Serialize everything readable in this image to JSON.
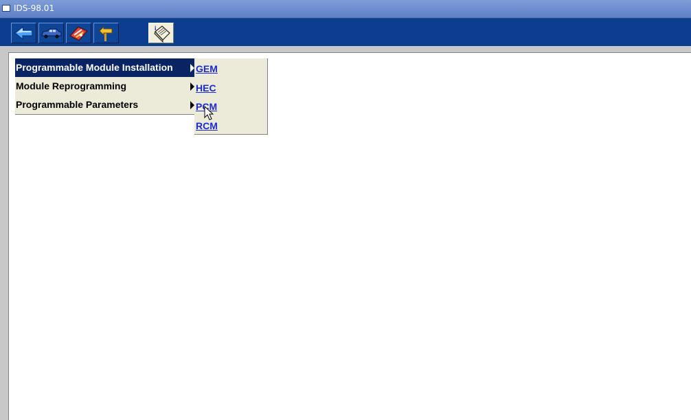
{
  "window": {
    "title": "IDS-98.01"
  },
  "toolbar": {
    "buttons": [
      {
        "icon": "back-arrow-icon"
      },
      {
        "icon": "vehicle-icon"
      },
      {
        "icon": "toolbox-icon"
      },
      {
        "icon": "signpost-icon"
      },
      {
        "icon": "info-notebook-icon"
      }
    ]
  },
  "menu": {
    "items": [
      {
        "label": "Programmable Module Installation",
        "selected": true
      },
      {
        "label": "Module Reprogramming",
        "selected": false
      },
      {
        "label": "Programmable Parameters",
        "selected": false
      }
    ]
  },
  "submenu": {
    "items": [
      {
        "label": "GEM"
      },
      {
        "label": "HEC"
      },
      {
        "label": "PCM"
      },
      {
        "label": "RCM"
      }
    ]
  },
  "colors": {
    "toolbar_bg": "#0b3e8f",
    "menu_bg": "#ecead9",
    "selection_bg": "#0a2463",
    "link": "#1a2ccf"
  }
}
